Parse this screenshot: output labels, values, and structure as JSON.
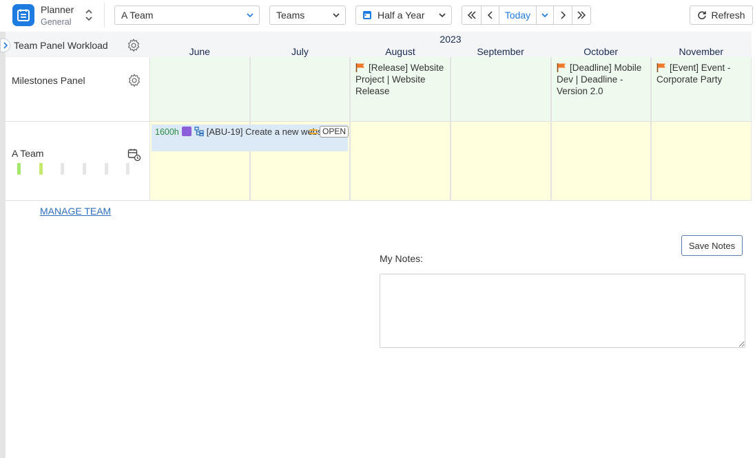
{
  "app": {
    "name": "Planner",
    "subtitle": "General"
  },
  "toolbar": {
    "team_select": "A Team",
    "view_select": "Teams",
    "period_select": "Half a Year",
    "today_label": "Today",
    "refresh_label": "Refresh"
  },
  "timeline": {
    "year": "2023",
    "months": [
      "June",
      "July",
      "August",
      "September",
      "October",
      "November"
    ]
  },
  "panels": {
    "workload_label": "Team Panel Workload",
    "milestones_label": "Milestones Panel",
    "team_label": "A Team"
  },
  "milestones": [
    {
      "text": "[Release] Website Project | Website Release",
      "month_index": 2
    },
    {
      "text": "[Deadline] Mobile Dev | Deadline - Version 2.0",
      "month_index": 4
    },
    {
      "text": "[Event] Event - Corporate Party",
      "month_index": 5
    }
  ],
  "task": {
    "hours": "1600h",
    "key_title": "[ABU-19] Create a new website",
    "status": "OPEN"
  },
  "workload_bars": [
    {
      "color": "#a6e86e"
    },
    {
      "color": "#c6e86e"
    },
    {
      "color": "#e6e6e6"
    },
    {
      "color": "#e6e6e6"
    },
    {
      "color": "#e6e6e6"
    },
    {
      "color": "#e6e6e6"
    }
  ],
  "manage_team_label": "MANAGE TEAM",
  "notes": {
    "label": "My Notes:",
    "save_label": "Save Notes",
    "value": ""
  },
  "colors": {
    "accent": "#1e7be0",
    "milestone_row": "#effaee",
    "team_row": "#ffffde"
  }
}
